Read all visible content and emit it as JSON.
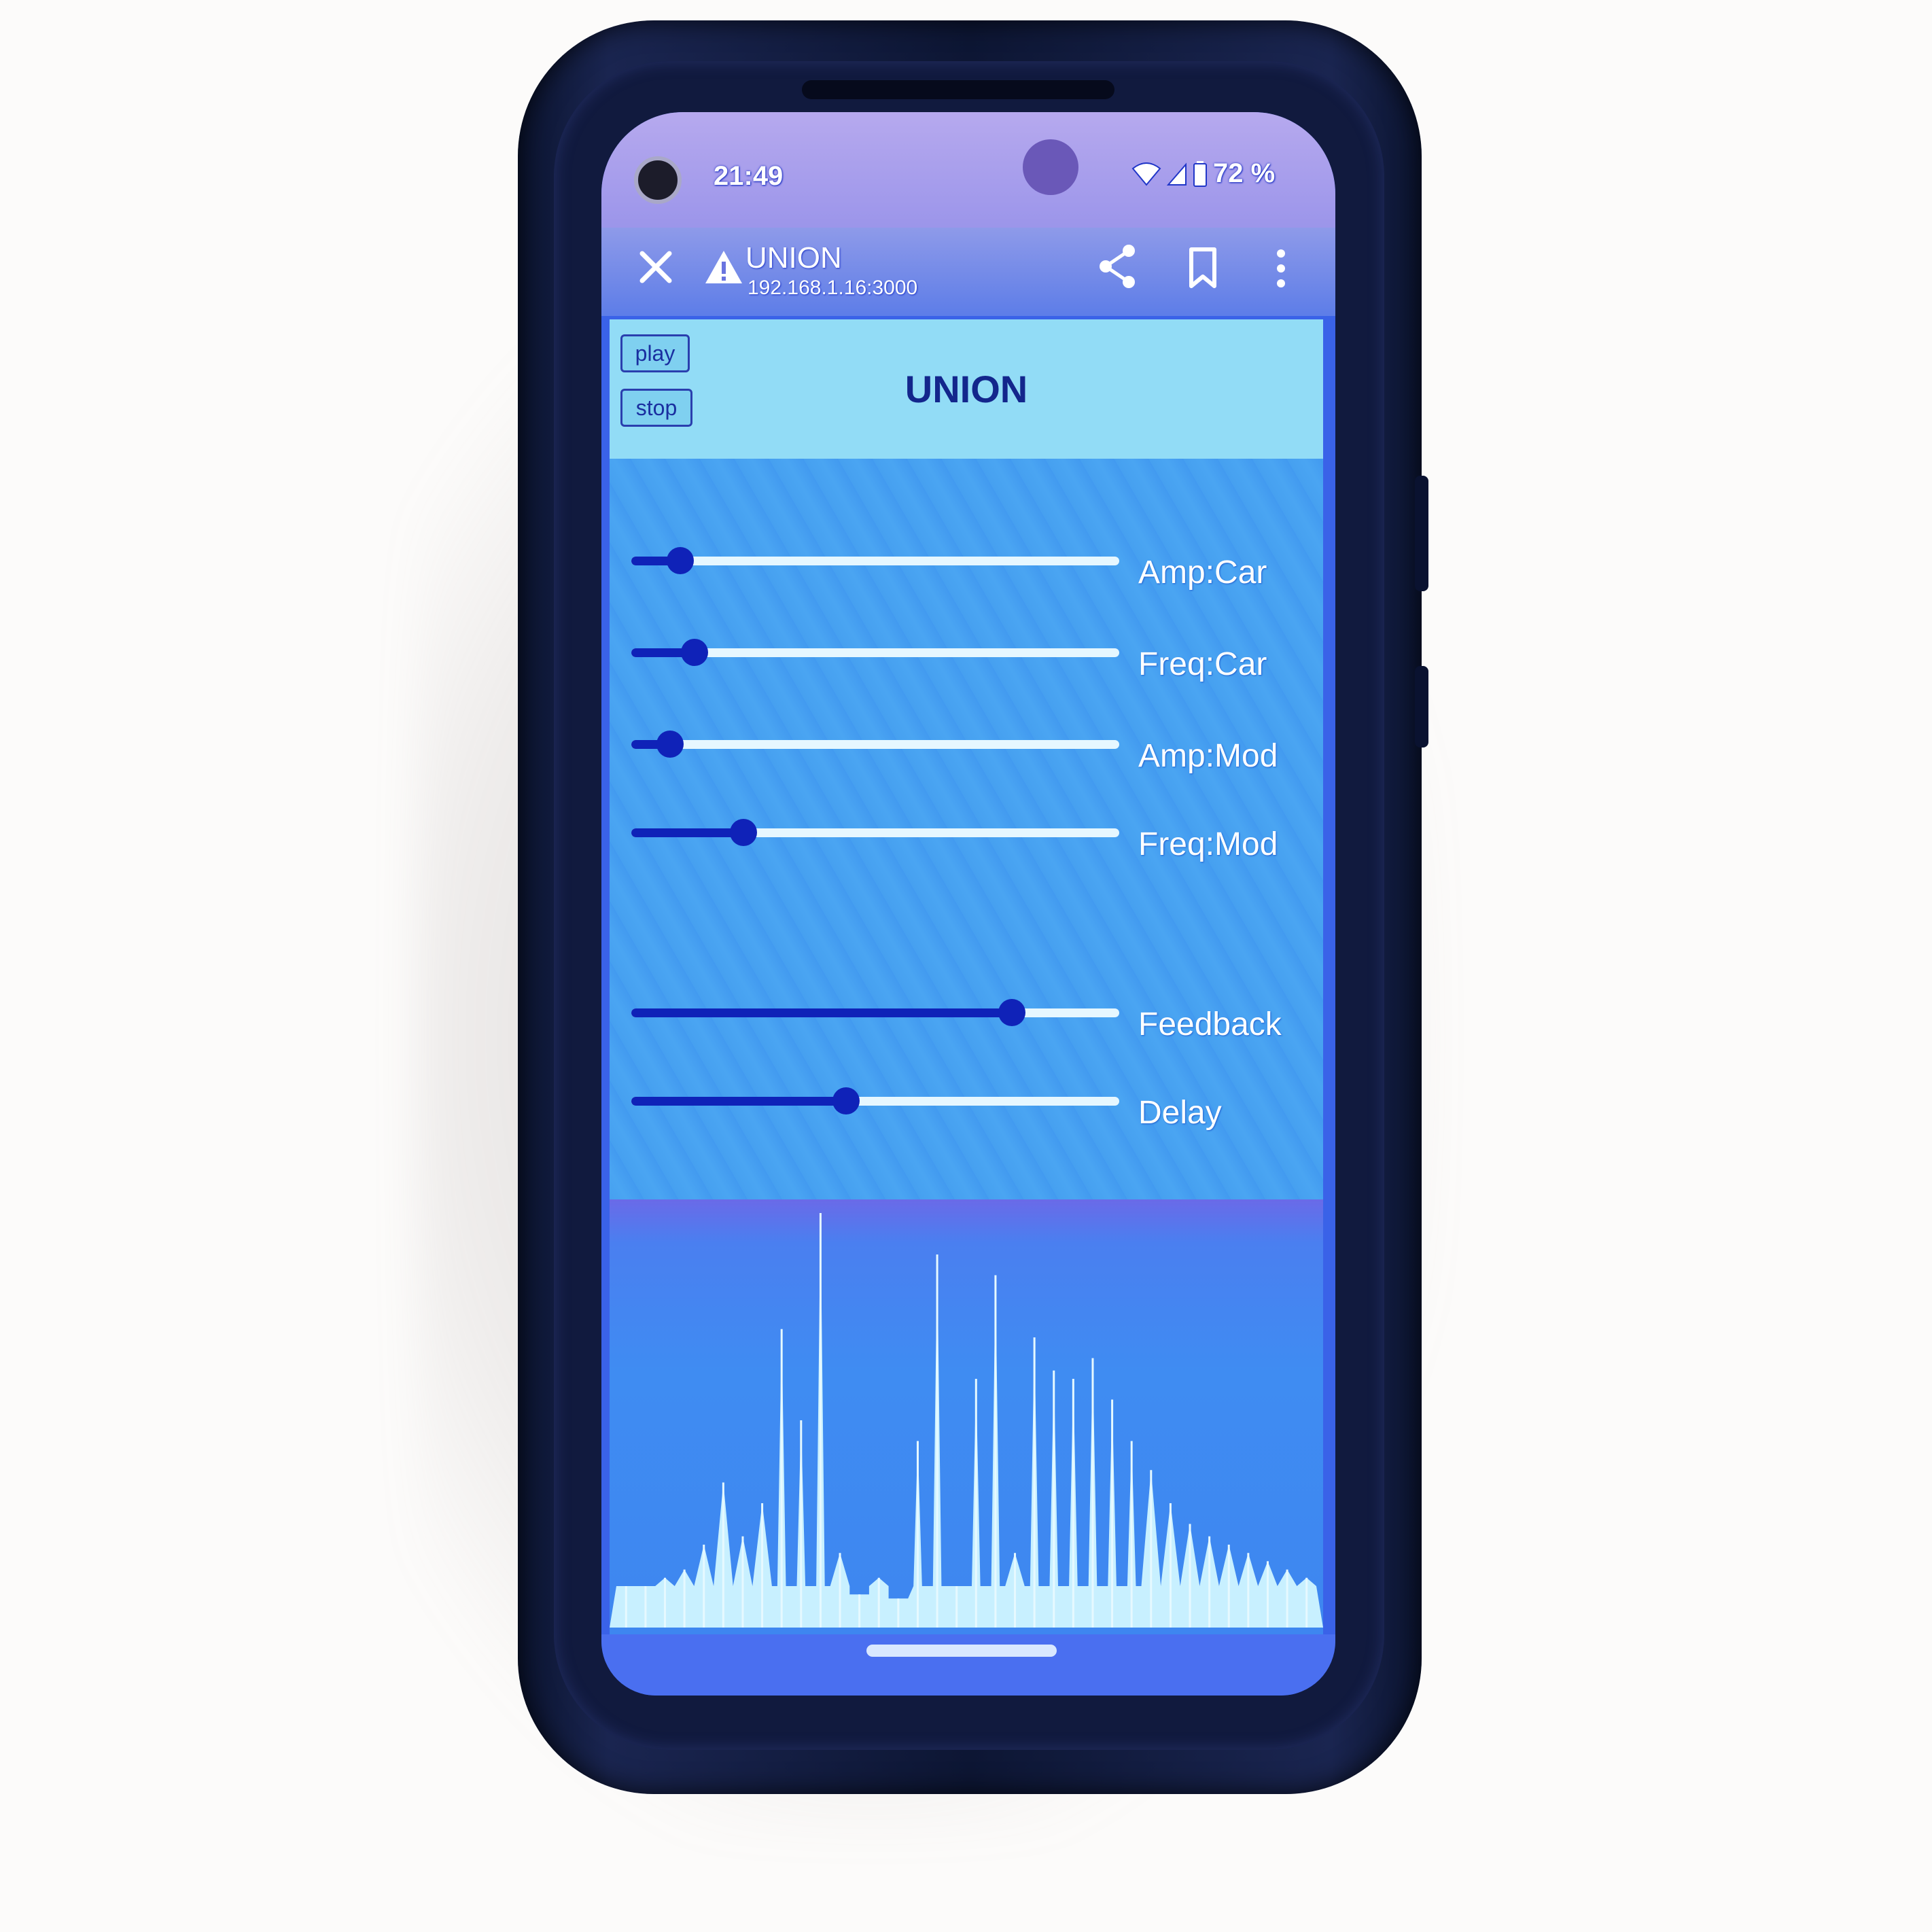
{
  "status_bar": {
    "time": "21:49",
    "battery": "72 %"
  },
  "browser_toolbar": {
    "title": "UNION",
    "url": "192.168.1.16:3000",
    "icons": [
      "close-icon",
      "warning-icon",
      "share-icon",
      "bookmark-icon",
      "more-vert-icon"
    ]
  },
  "app": {
    "title": "UNION",
    "play_label": "play",
    "stop_label": "stop"
  },
  "sliders": [
    {
      "label": "Amp:Car",
      "value": 0.1
    },
    {
      "label": "Freq:Car",
      "value": 0.13
    },
    {
      "label": "Amp:Mod",
      "value": 0.08
    },
    {
      "label": "Freq:Mod",
      "value": 0.23
    },
    {
      "label": "Feedback",
      "value": 0.78
    },
    {
      "label": "Delay",
      "value": 0.44
    }
  ],
  "spectrum": {
    "peak_levels": [
      0.1,
      0.1,
      0.12,
      0.14,
      0.2,
      0.35,
      0.22,
      0.3,
      0.72,
      0.5,
      1.0,
      0.18,
      0.08,
      0.12,
      0.07,
      0.45,
      0.9,
      0.1,
      0.6,
      0.85,
      0.18,
      0.7,
      0.62,
      0.6,
      0.65,
      0.55,
      0.45,
      0.38,
      0.3,
      0.25,
      0.22,
      0.2,
      0.18,
      0.16,
      0.14,
      0.12
    ]
  },
  "colors": {
    "header_bg": "#92dcf6",
    "controls_bg": "#46a0f0",
    "slider_fill": "#0f22b8",
    "slider_track": "#e6f7ff",
    "spectrum_fill": "#c8f0ff"
  }
}
